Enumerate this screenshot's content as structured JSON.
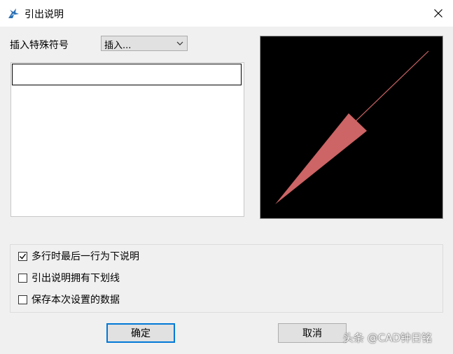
{
  "window": {
    "title": "引出说明",
    "icon": "leader-app-icon",
    "close_icon": "close-icon"
  },
  "symbol": {
    "label": "插入特殊符号",
    "combo_value": "插入..."
  },
  "text_input": {
    "value": ""
  },
  "options": [
    {
      "label": "多行时最后一行为下说明",
      "checked": true
    },
    {
      "label": "引出说明拥有下划线",
      "checked": false
    },
    {
      "label": "保存本次设置的数据",
      "checked": false
    }
  ],
  "buttons": {
    "ok": "确定",
    "cancel": "取消"
  },
  "preview": {
    "background": "#000000",
    "leader_color": "#cd6465"
  },
  "watermark": "头条 @CAD钟日铭"
}
